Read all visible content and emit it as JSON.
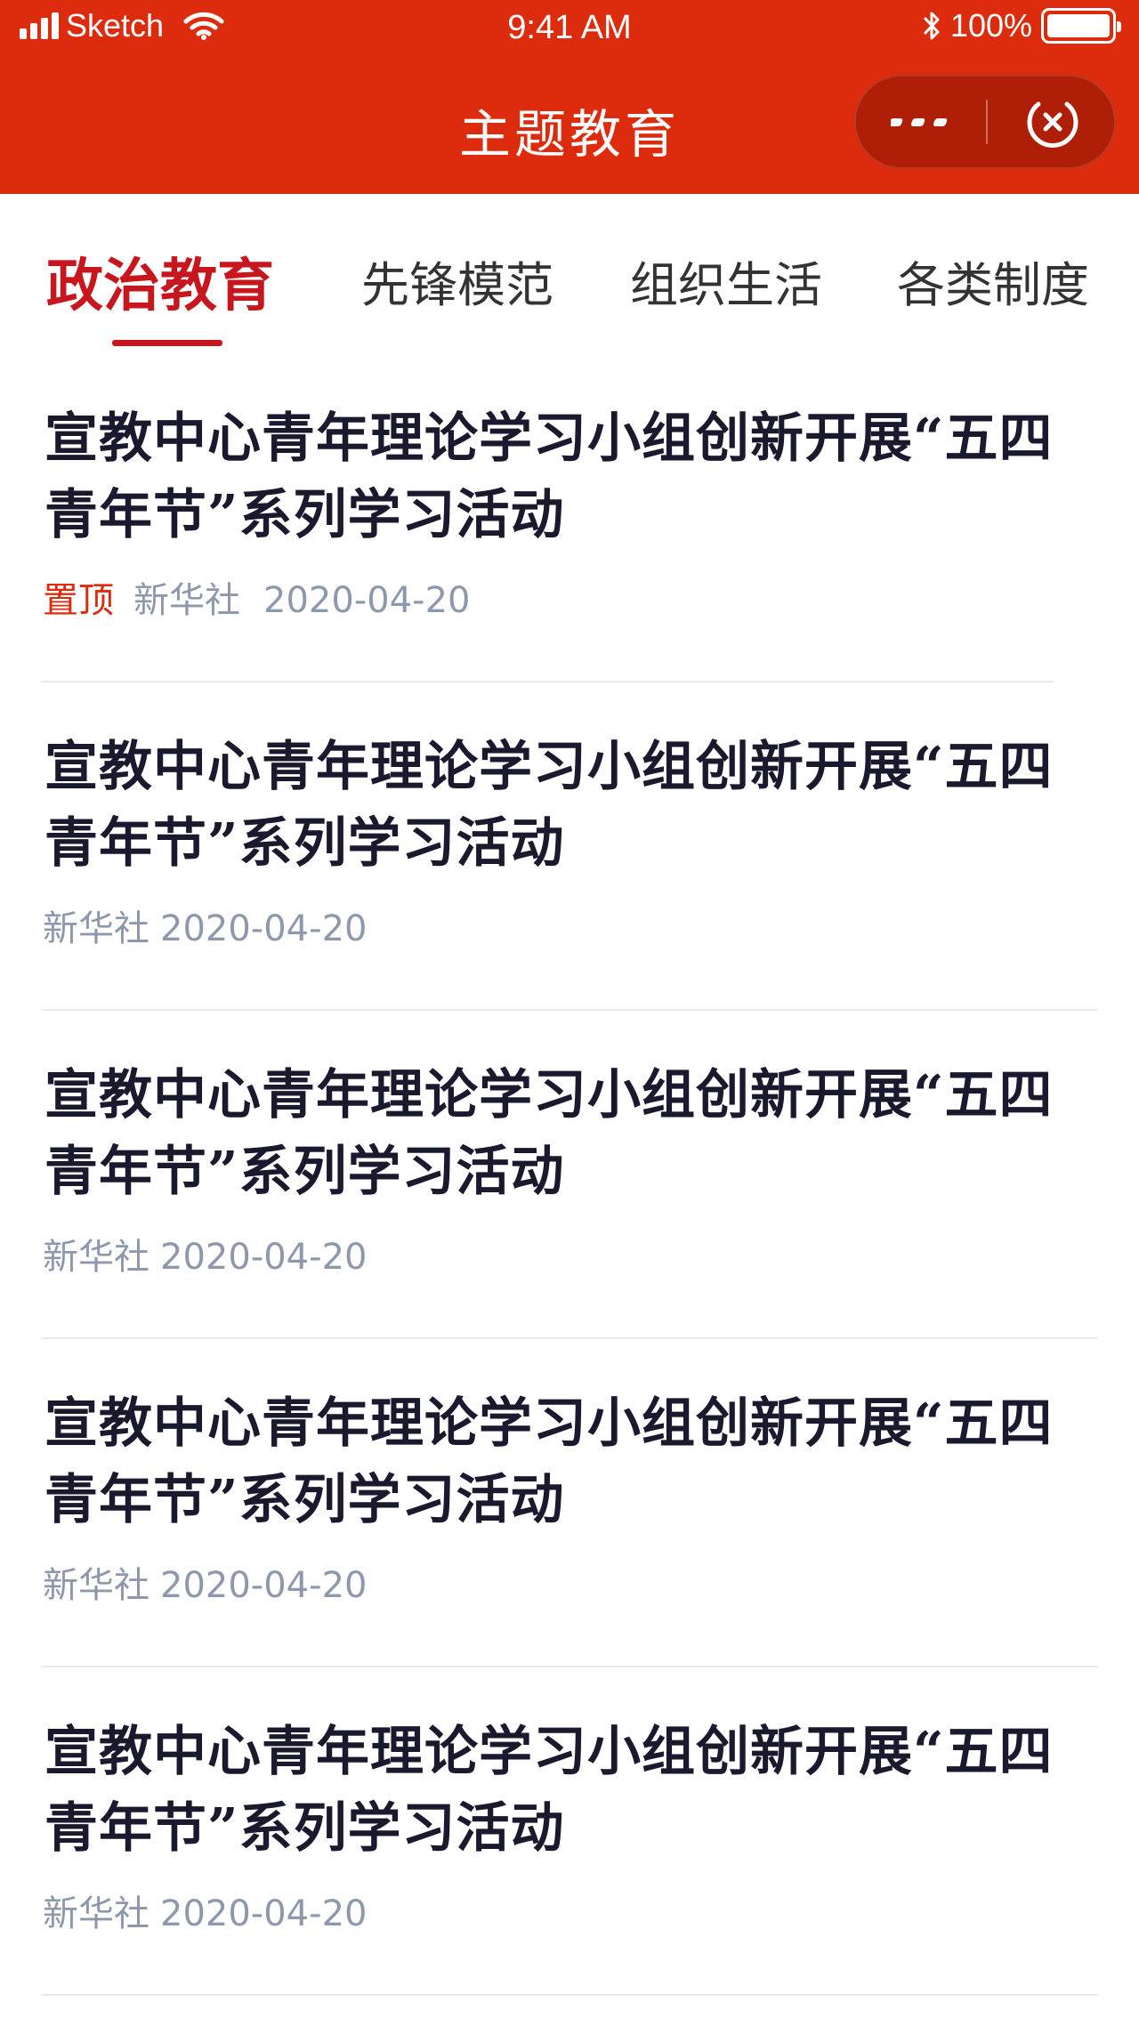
{
  "status_bar": {
    "carrier": "Sketch",
    "time": "9:41 AM",
    "battery_pct": "100%",
    "battery_level": 1.0
  },
  "nav": {
    "title": "主题教育",
    "capsule_more_icon": "more-dots-icon",
    "capsule_close_icon": "close-circle-icon"
  },
  "tabs": [
    {
      "label": "政治教育",
      "active": true
    },
    {
      "label": "先锋模范",
      "active": false
    },
    {
      "label": "组织生活",
      "active": false
    },
    {
      "label": "各类制度",
      "active": false
    }
  ],
  "articles": [
    {
      "title": "宣教中心青年理论学习小组创新开展“五四青年节”系列学习活动",
      "pin": "置顶",
      "source": "新华社",
      "date": "2020-04-20"
    },
    {
      "title": "宣教中心青年理论学习小组创新开展“五四青年节”系列学习活动",
      "source": "新华社",
      "date": "2020-04-20"
    },
    {
      "title": "宣教中心青年理论学习小组创新开展“五四青年节”系列学习活动",
      "source": "新华社",
      "date": "2020-04-20"
    },
    {
      "title": "宣教中心青年理论学习小组创新开展“五四青年节”系列学习活动",
      "source": "新华社",
      "date": "2020-04-20"
    },
    {
      "title": "宣教中心青年理论学习小组创新开展“五四青年节”系列学习活动",
      "source": "新华社",
      "date": "2020-04-20"
    }
  ],
  "colors": {
    "header_bg": "#dd2b0e",
    "accent": "#c7161e",
    "meta_text": "#8e98ac",
    "title_text": "#1a1a2e"
  }
}
